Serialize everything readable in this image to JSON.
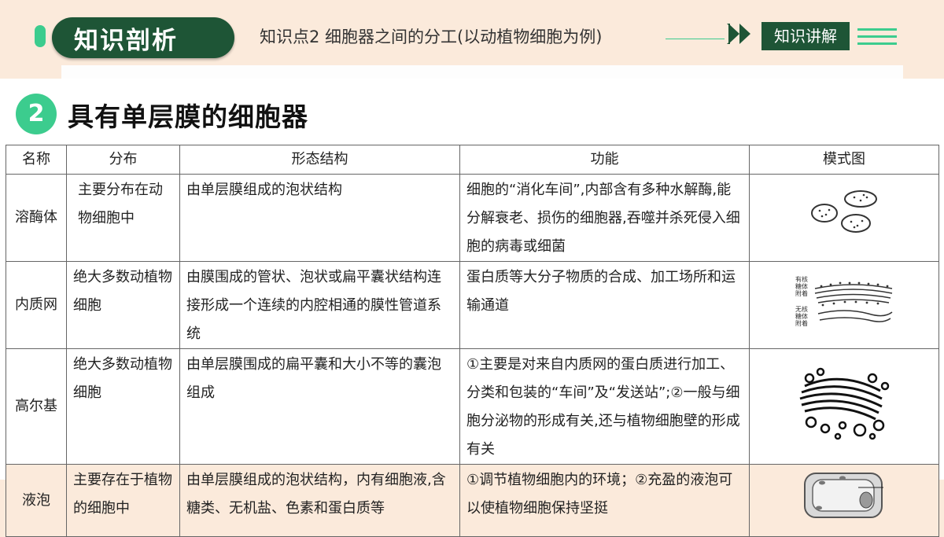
{
  "header": {
    "badge": "知识剖析",
    "topic": "知识点2  细胞器之间的分工(以动植物细胞为例)",
    "explain_button": "知识讲解",
    "icons": [
      "logo-pill",
      "double-arrow-icon",
      "menu-icon"
    ]
  },
  "section": {
    "number": "2",
    "title": "具有单层膜的细胞器"
  },
  "table": {
    "columns": [
      "名称",
      "分布",
      "形态结构",
      "功能",
      "模式图"
    ],
    "rows": [
      {
        "name": "溶酶体",
        "distribution": "主要分布在动物细胞中",
        "structure": "由单层膜组成的泡状结构",
        "function": "细胞的“消化车间”,内部含有多种水解酶,能分解衰老、损伤的细胞器,吞噬并杀死侵入细胞的病毒或细菌"
      },
      {
        "name": "内质网",
        "distribution": "绝大多数动植物细胞",
        "structure": "由膜围成的管状、泡状或扁平囊状结构连接形成一个连续的内腔相通的膜性管道系统",
        "function": "蛋白质等大分子物质的合成、加工场所和运输通道",
        "diagram_labels": [
          "有核糖体附着",
          "无核糖体附着"
        ]
      },
      {
        "name": "高尔基",
        "distribution": "绝大多数动植物细胞",
        "structure": "由单层膜围成的扁平囊和大小不等的囊泡组成",
        "function": "①主要是对来自内质网的蛋白质进行加工、分类和包装的“车间”及“发送站”;②一般与细胞分泌物的形成有关,还与植物细胞壁的形成有关"
      },
      {
        "name": "液泡",
        "distribution": "主要存在于植物的细胞中",
        "structure": "由单层膜组成的泡状结构，内有细胞液,含糖类、无机盐、色素和蛋白质等",
        "function": "①调节植物细胞内的环境；②充盈的液泡可以使植物细胞保持坚挺"
      }
    ]
  },
  "colors": {
    "accent_green": "#3ccc8e",
    "dark_green": "#1e5536",
    "peach_bg": "#fbeadb"
  }
}
